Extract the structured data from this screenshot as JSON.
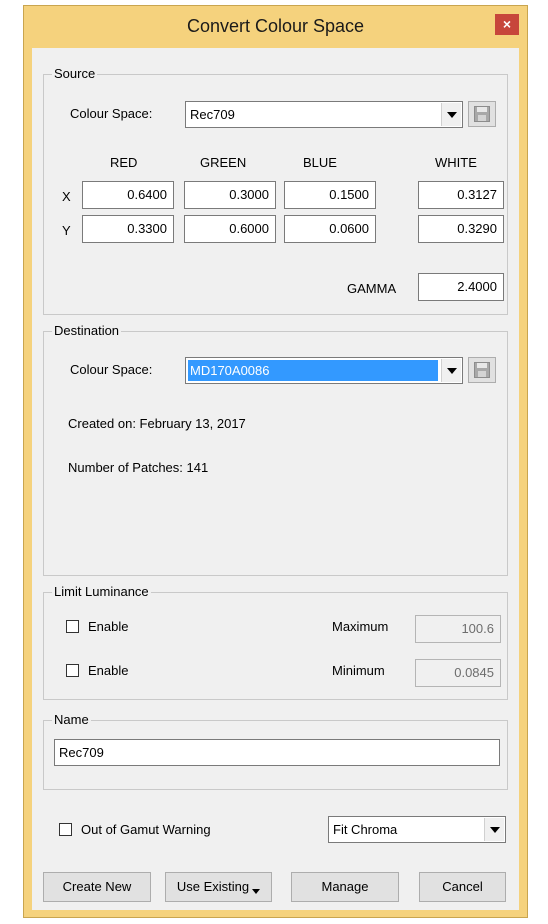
{
  "window": {
    "title": "Convert Colour Space",
    "close_glyph": "×"
  },
  "source": {
    "legend": "Source",
    "colour_space_label": "Colour Space:",
    "colour_space_value": "Rec709",
    "headers": {
      "red": "RED",
      "green": "GREEN",
      "blue": "BLUE",
      "white": "WHITE"
    },
    "row_x_label": "X",
    "row_y_label": "Y",
    "x": {
      "red": "0.6400",
      "green": "0.3000",
      "blue": "0.1500",
      "white": "0.3127"
    },
    "y": {
      "red": "0.3300",
      "green": "0.6000",
      "blue": "0.0600",
      "white": "0.3290"
    },
    "gamma_label": "GAMMA",
    "gamma_value": "2.4000"
  },
  "destination": {
    "legend": "Destination",
    "colour_space_label": "Colour Space:",
    "colour_space_value": "MD170A0086",
    "created_on": "Created on: February 13, 2017",
    "patches": "Number of Patches: 141"
  },
  "limit_luminance": {
    "legend": "Limit Luminance",
    "max_enable_label": "Enable",
    "min_enable_label": "Enable",
    "maximum_label": "Maximum",
    "maximum_value": "100.6",
    "minimum_label": "Minimum",
    "minimum_value": "0.0845"
  },
  "name_group": {
    "legend": "Name",
    "value": "Rec709"
  },
  "options": {
    "gamut_warning_label": "Out of Gamut Warning",
    "mapping_value": "Fit Chroma"
  },
  "buttons": {
    "create_new": "Create New",
    "use_existing": "Use Existing",
    "manage": "Manage",
    "cancel": "Cancel"
  },
  "colors": {
    "frame": "#f5d27d",
    "close": "#c7463b",
    "selection": "#3399ff"
  },
  "icons": {
    "save": "save-disk-icon",
    "dropdown": "chevron-down-icon"
  }
}
